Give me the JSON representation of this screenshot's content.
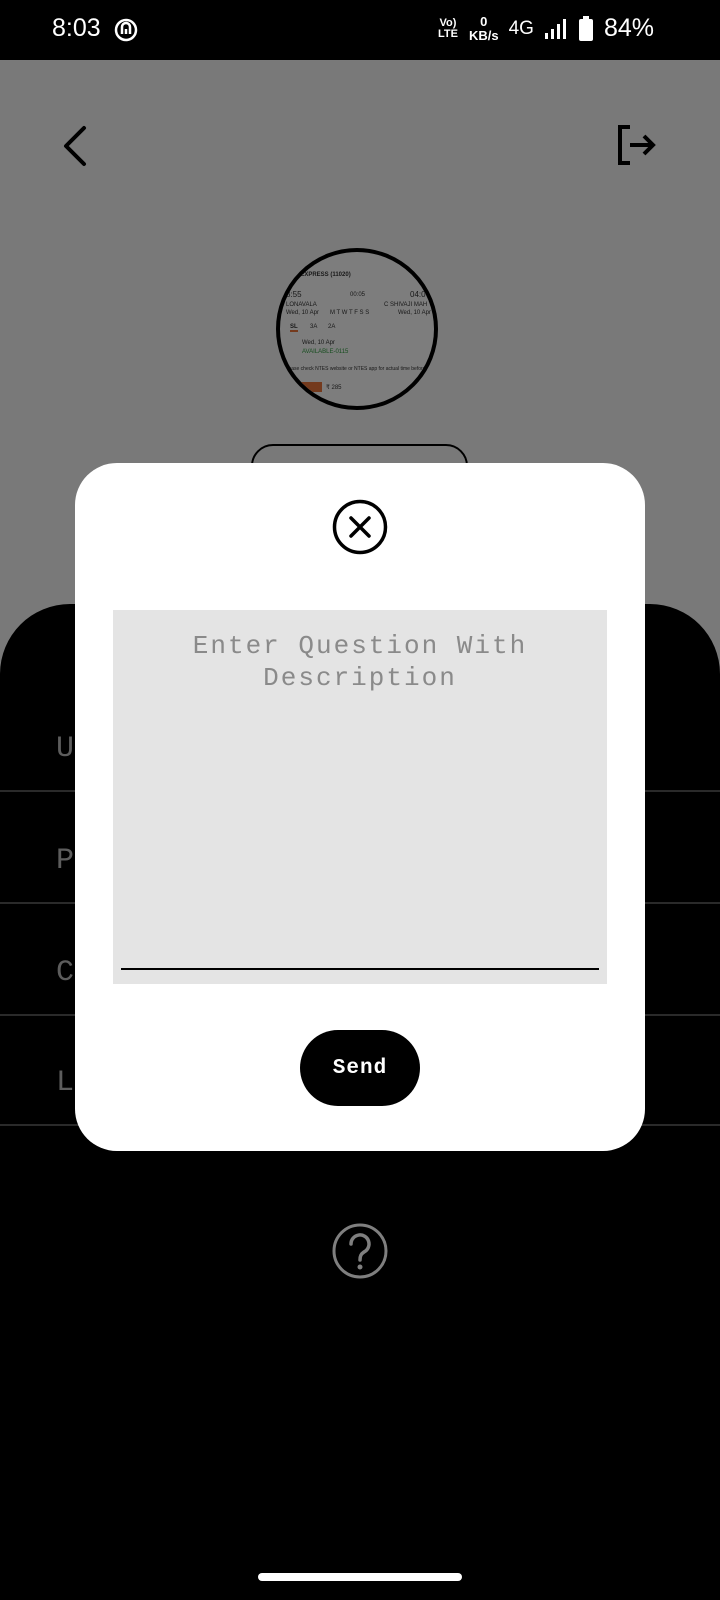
{
  "status_bar": {
    "time": "8:03",
    "volte": "Vo)\nLTE",
    "speed_value": "0",
    "speed_unit": "KB/s",
    "network": "4G",
    "battery_percent": "84%",
    "icons": [
      "app-notification-icon",
      "signal-icon",
      "battery-icon"
    ]
  },
  "background_screen": {
    "top_left_icon": "back-arrow-icon",
    "top_right_icon": "logout-icon",
    "profile_image_texts": {
      "train_title": "RK EXPRESS (11020)",
      "dep_time": "3:55",
      "duration": "00:05",
      "arr_time": "04:0",
      "from_station": "LONAVALA",
      "to_station": "C SHIVAJI MAH T",
      "from_date": "Wed, 10 Apr",
      "days": "M T W T F S S",
      "to_date": "Wed, 10 Apr",
      "class_sl": "SL",
      "class_3a": "3A",
      "class_2a": "2A",
      "avail_date": "Wed, 10 Apr",
      "avail_status": "AVAILABLE-0115",
      "note": "Please check NTES website or NTES app for actual time before",
      "price": "₹ 285"
    },
    "rows": [
      {
        "label": "U"
      },
      {
        "label": "P"
      },
      {
        "label": "C"
      },
      {
        "label": "L"
      }
    ],
    "help_icon": "question-circle-icon"
  },
  "modal": {
    "close_icon": "close-icon",
    "input_placeholder": "Enter Question With Description",
    "input_value": "",
    "send_label": "Send"
  }
}
